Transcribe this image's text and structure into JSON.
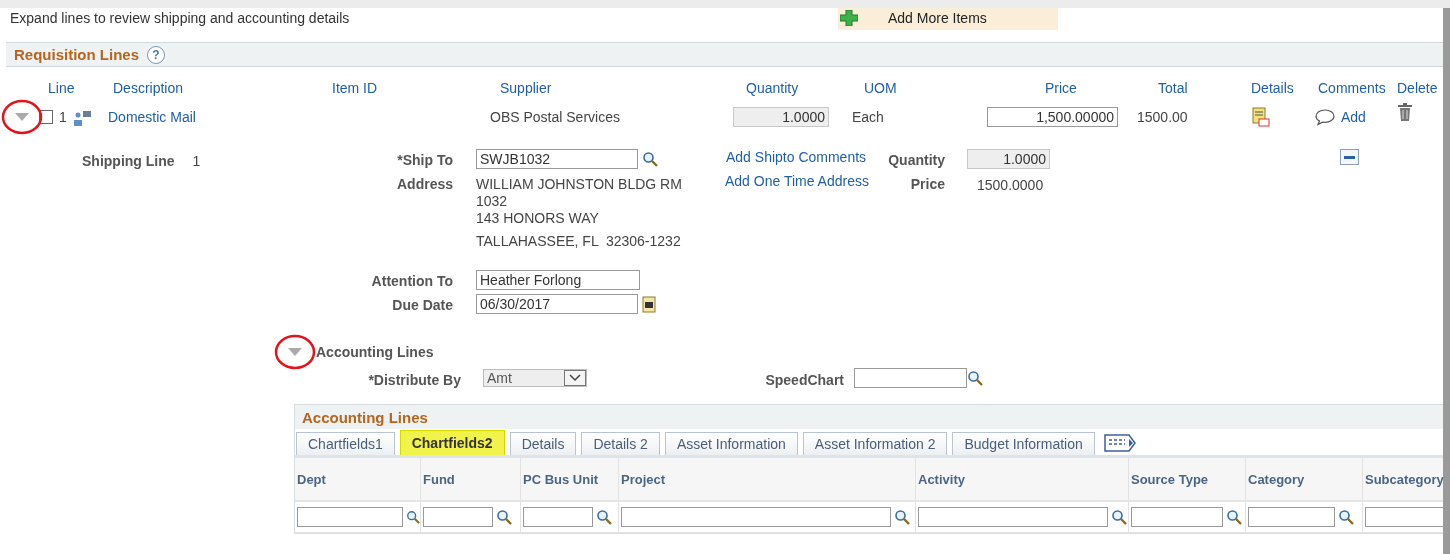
{
  "instruction": "Expand lines to review shipping and accounting details",
  "add_items_button": "Add More Items",
  "requisition_lines": {
    "title": "Requisition Lines",
    "help": "?",
    "columns": [
      "Line",
      "Description",
      "Item ID",
      "Supplier",
      "Quantity",
      "UOM",
      "Price",
      "Total",
      "Details",
      "Comments",
      "Delete"
    ],
    "rows": [
      {
        "expanded": true,
        "checked": false,
        "line": "1",
        "description": "Domestic Mail",
        "supplier": "OBS Postal Services",
        "quantity": "1.0000",
        "uom": "Each",
        "price": "1,500.00000",
        "total": "1500.00",
        "comment_link": "Add"
      }
    ]
  },
  "shipping": {
    "label": "Shipping Line",
    "line": "1",
    "ship_to": {
      "label": "*Ship To",
      "value": "SWJB1032"
    },
    "address": {
      "label": "Address",
      "lines": [
        "WILLIAM JOHNSTON BLDG RM",
        "1032",
        "143 HONORS WAY",
        "TALLAHASSEE, FL  32306-1232"
      ]
    },
    "links": [
      "Add Shipto Comments",
      "Add One Time Address"
    ],
    "quantity": {
      "label": "Quantity",
      "value": "1.0000"
    },
    "price": {
      "label": "Price",
      "value": "1500.0000"
    },
    "attention": {
      "label": "Attention To",
      "value": "Heather Forlong"
    },
    "due_date": {
      "label": "Due Date",
      "value": "06/30/2017"
    }
  },
  "accounting": {
    "expanded": true,
    "title": "Accounting Lines",
    "distribute_by": {
      "label": "*Distribute By",
      "value": "Amt"
    },
    "speedchart": {
      "label": "SpeedChart"
    },
    "grid": {
      "title": "Accounting Lines",
      "tabs": [
        {
          "label": "Chartfields1",
          "selected": false
        },
        {
          "label": "Chartfields2",
          "selected": true
        },
        {
          "label": "Details",
          "selected": false
        },
        {
          "label": "Details 2",
          "selected": false
        },
        {
          "label": "Asset Information",
          "selected": false
        },
        {
          "label": "Asset Information 2",
          "selected": false
        },
        {
          "label": "Budget Information",
          "selected": false
        }
      ],
      "columns": [
        "Dept",
        "Fund",
        "PC Bus Unit",
        "Project",
        "Activity",
        "Source Type",
        "Category",
        "Subcategory"
      ]
    }
  }
}
